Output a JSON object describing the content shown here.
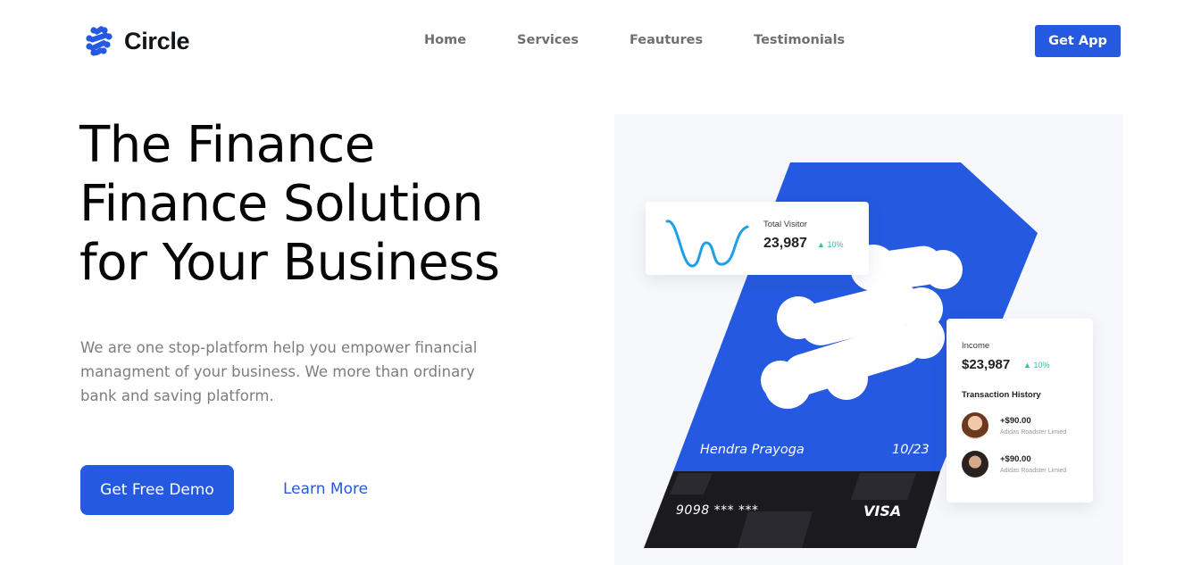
{
  "brand": {
    "name": "Circle",
    "logo_icon": "circle-molecule-icon",
    "color": "#2459e0"
  },
  "nav": {
    "items": [
      "Home",
      "Services",
      "Feautures",
      "Testimonials"
    ],
    "cta_label": "Get App"
  },
  "hero": {
    "title_lines": [
      "The Finance",
      "Finance Solution",
      "for Your Business"
    ],
    "description": "We are one stop-platform help you empower financial managment of your business. We more than ordinary bank and saving platform.",
    "primary_cta": "Get Free Demo",
    "secondary_cta": "Learn More"
  },
  "illustration": {
    "visitor_card": {
      "label": "Total Visitor",
      "value": "23,987",
      "change": "10%",
      "icon": "trend-up-icon",
      "sparkline_icon": "sparkline-chart-icon"
    },
    "income_card": {
      "label": "Income",
      "value": "$23,987",
      "change": "10%",
      "icon": "trend-up-icon",
      "history_title": "Transaction History",
      "transactions": [
        {
          "amount": "+$90.00",
          "description": "Adidas Roadster Limied",
          "avatar": "woman-avatar"
        },
        {
          "amount": "+$90.00",
          "description": "Adidas Roadster Limied",
          "avatar": "man-avatar"
        }
      ]
    },
    "credit_card": {
      "holder": "Hendra Prayoga",
      "expiry": "10/23",
      "number": "9098 *** ***",
      "brand": "VISA"
    },
    "colors": {
      "card_blue": "#2459e0",
      "card_dark": "#1b1b1f",
      "positive": "#2ec4a0"
    }
  }
}
